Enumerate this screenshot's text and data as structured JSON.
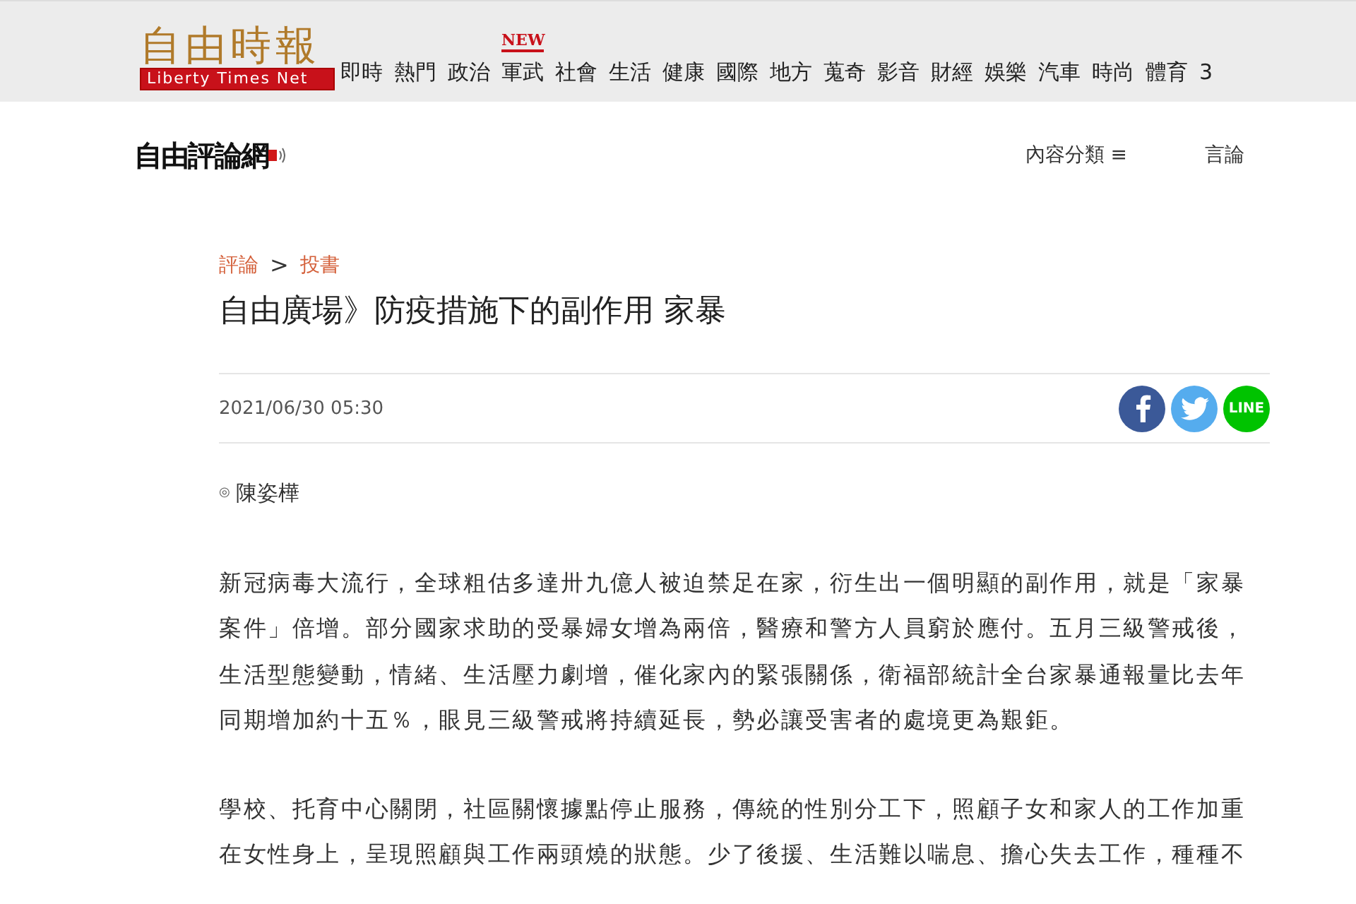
{
  "top_bar": {
    "logo": {
      "title": "自由時報",
      "subtitle": "Liberty Times Net"
    },
    "nav": [
      {
        "label": "即時"
      },
      {
        "label": "熱門"
      },
      {
        "label": "政治"
      },
      {
        "label": "軍武",
        "badge": "NEW"
      },
      {
        "label": "社會"
      },
      {
        "label": "生活"
      },
      {
        "label": "健康"
      },
      {
        "label": "國際"
      },
      {
        "label": "地方"
      },
      {
        "label": "蒐奇"
      },
      {
        "label": "影音"
      },
      {
        "label": "財經"
      },
      {
        "label": "娛樂"
      },
      {
        "label": "汽車"
      },
      {
        "label": "時尚"
      },
      {
        "label": "體育"
      },
      {
        "label": "3"
      }
    ]
  },
  "section_bar": {
    "logo": "自由評論網",
    "links": [
      {
        "label": "內容分類 ≡"
      },
      {
        "label": "言論"
      }
    ]
  },
  "article": {
    "breadcrumb": [
      "評論",
      "投書"
    ],
    "separator": ">",
    "title": "自由廣場》防疫措施下的副作用 家暴",
    "date": "2021/06/30 05:30",
    "share": [
      {
        "kind": "facebook",
        "color": "#3b5998"
      },
      {
        "kind": "twitter",
        "color": "#55acee"
      },
      {
        "kind": "line",
        "label": "LINE",
        "color": "#00c300"
      }
    ],
    "author_mark": "◎",
    "author": "陳姿樺",
    "paragraphs": [
      {
        "lines": [
          "新冠病毒大流行，全球粗估多達卅九億人被迫禁足在家，衍生出一個明顯的副作用，就是「家暴",
          "案件」倍增。部分國家求助的受暴婦女增為兩倍，醫療和警方人員窮於應付。五月三級警戒後，",
          "生活型態變動，情緒、生活壓力劇增，催化家內的緊張關係，衛福部統計全台家暴通報量比去年",
          "同期增加約十五％，眼見三級警戒將持續延長，勢必讓受害者的處境更為艱鉅。"
        ]
      },
      {
        "lines": [
          "學校、托育中心關閉，社區關懷據點停止服務，傳統的性別分工下，照顧子女和家人的工作加重",
          "在女性身上，呈現照顧與工作兩頭燒的狀態。少了後援、生活難以喘息、擔心失去工作，種種不"
        ]
      }
    ]
  }
}
